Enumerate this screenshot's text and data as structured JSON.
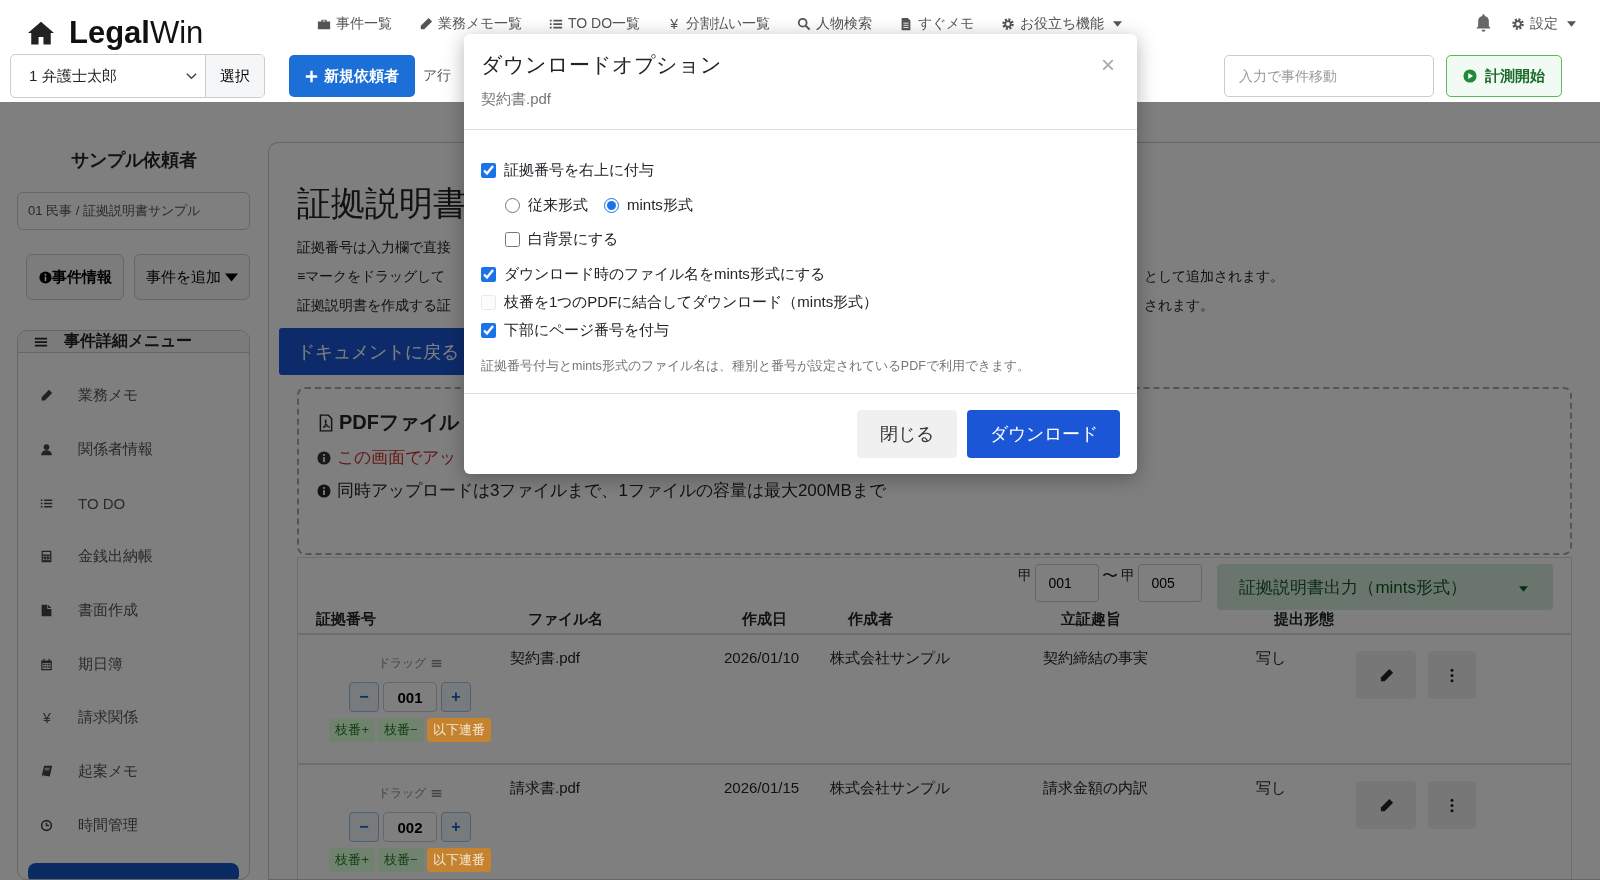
{
  "navbar": {
    "logo": "**Legal**Win",
    "menu": [
      {
        "label": "事件一覧"
      },
      {
        "label": "業務メモ一覧"
      },
      {
        "label": "TO DO一覧"
      },
      {
        "glyph": "¥",
        "label": "分割払い一覧"
      },
      {
        "label": "人物検索"
      },
      {
        "label": "すぐメモ"
      },
      {
        "label": "お役立ち機能",
        "dropdown": true
      }
    ],
    "settings": "設定",
    "user_select": "1 弁護士太郎",
    "select_button": "選択",
    "new_client_button": "新規依頼者",
    "kana_filter": "ア行",
    "case_jump": {
      "placeholder": "入力で事件移動"
    },
    "timer_button": "計測開始"
  },
  "sidebar": {
    "client_name": "サンプル依頼者",
    "case_label": "01 民事 / 証拠説明書サンプル",
    "case_info_button": "事件情報",
    "add_case_button": "事件を追加",
    "menu_title": "事件詳細メニュー",
    "items": [
      {
        "label": "業務メモ"
      },
      {
        "label": "関係者情報"
      },
      {
        "label": "TO DO"
      },
      {
        "label": "金銭出納帳"
      },
      {
        "label": "書面作成"
      },
      {
        "label": "期日簿"
      },
      {
        "glyph": "¥",
        "label": "請求関係"
      },
      {
        "label": "起案メモ"
      },
      {
        "label": "時間管理"
      }
    ]
  },
  "main": {
    "title": "証拠説明書",
    "help_lines": [
      {
        "left": "証拠番号は入力欄で直接"
      },
      {
        "left": "≡マークをドラッグして",
        "right": "として追加されます。"
      },
      {
        "left": "証拠説明書を作成する証",
        "right": "されます。"
      }
    ],
    "back_button": "ドキュメントに戻る",
    "upload": {
      "heading": "PDFファイル",
      "warning": "この画面でアッ",
      "note": "同時アップロードは3ファイルまで、1ファイルの容量は最大200MBまで"
    },
    "range": {
      "from_prefix": "甲",
      "from": "001",
      "separator": "〜",
      "to_prefix": "甲",
      "to": "005"
    },
    "export_button": "証拠説明書出力（mints形式）",
    "table": {
      "columns": [
        "証拠番号",
        "ファイル名",
        "作成日",
        "作成者",
        "立証趣旨",
        "提出形態"
      ],
      "rows": [
        {
          "drag_label": "ドラッグ",
          "minus": "−",
          "number": "001",
          "plus": "+",
          "tags": [
            {
              "label": "枝番+",
              "color": "#6f836f"
            },
            {
              "label": "枝番−",
              "color": "#6f836f"
            },
            {
              "label": "以下連番",
              "color": "#c5832f"
            }
          ],
          "cells": [
            "",
            "契約書.pdf",
            "2026/01/10",
            "株式会社サンプル",
            "契約締結の事実",
            "写し"
          ]
        },
        {
          "drag_label": "ドラッグ",
          "minus": "−",
          "number": "002",
          "plus": "+",
          "tags": [
            {
              "label": "枝番+",
              "color": "#6f836f"
            },
            {
              "label": "枝番−",
              "color": "#6f836f"
            },
            {
              "label": "以下連番",
              "color": "#c5832f"
            }
          ],
          "cells": [
            "",
            "請求書.pdf",
            "2026/01/15",
            "株式会社サンプル",
            "請求金額の内訳",
            "写し"
          ]
        }
      ]
    }
  },
  "modal": {
    "title": "ダウンロードオプション",
    "close": "×",
    "subtitle": "契約書.pdf",
    "options": [
      {
        "kind": "checkbox",
        "label": "証拠番号を右上に付与",
        "checked": true,
        "disabled": false,
        "children": [
          {
            "kind": "radio",
            "items": [
              {
                "label": "従来形式",
                "selected": false
              },
              {
                "label": "mints形式",
                "selected": true
              }
            ]
          },
          {
            "kind": "checkbox",
            "label": "白背景にする",
            "checked": false,
            "disabled": false
          }
        ]
      },
      {
        "kind": "checkbox",
        "label": "ダウンロード時のファイル名をmints形式にする",
        "checked": true,
        "disabled": false
      },
      {
        "kind": "checkbox",
        "label": "枝番を1つのPDFに結合してダウンロード（mints形式）",
        "checked": false,
        "disabled": true
      },
      {
        "kind": "checkbox",
        "label": "下部にページ番号を付与",
        "checked": true,
        "disabled": false
      }
    ],
    "note": "証拠番号付与とmints形式のファイル名は、種別と番号が設定されているPDFで利用できます。",
    "buttons": [
      {
        "label": "閉じる",
        "kind": "secondary"
      },
      {
        "label": "ダウンロード",
        "kind": "primary"
      }
    ]
  }
}
